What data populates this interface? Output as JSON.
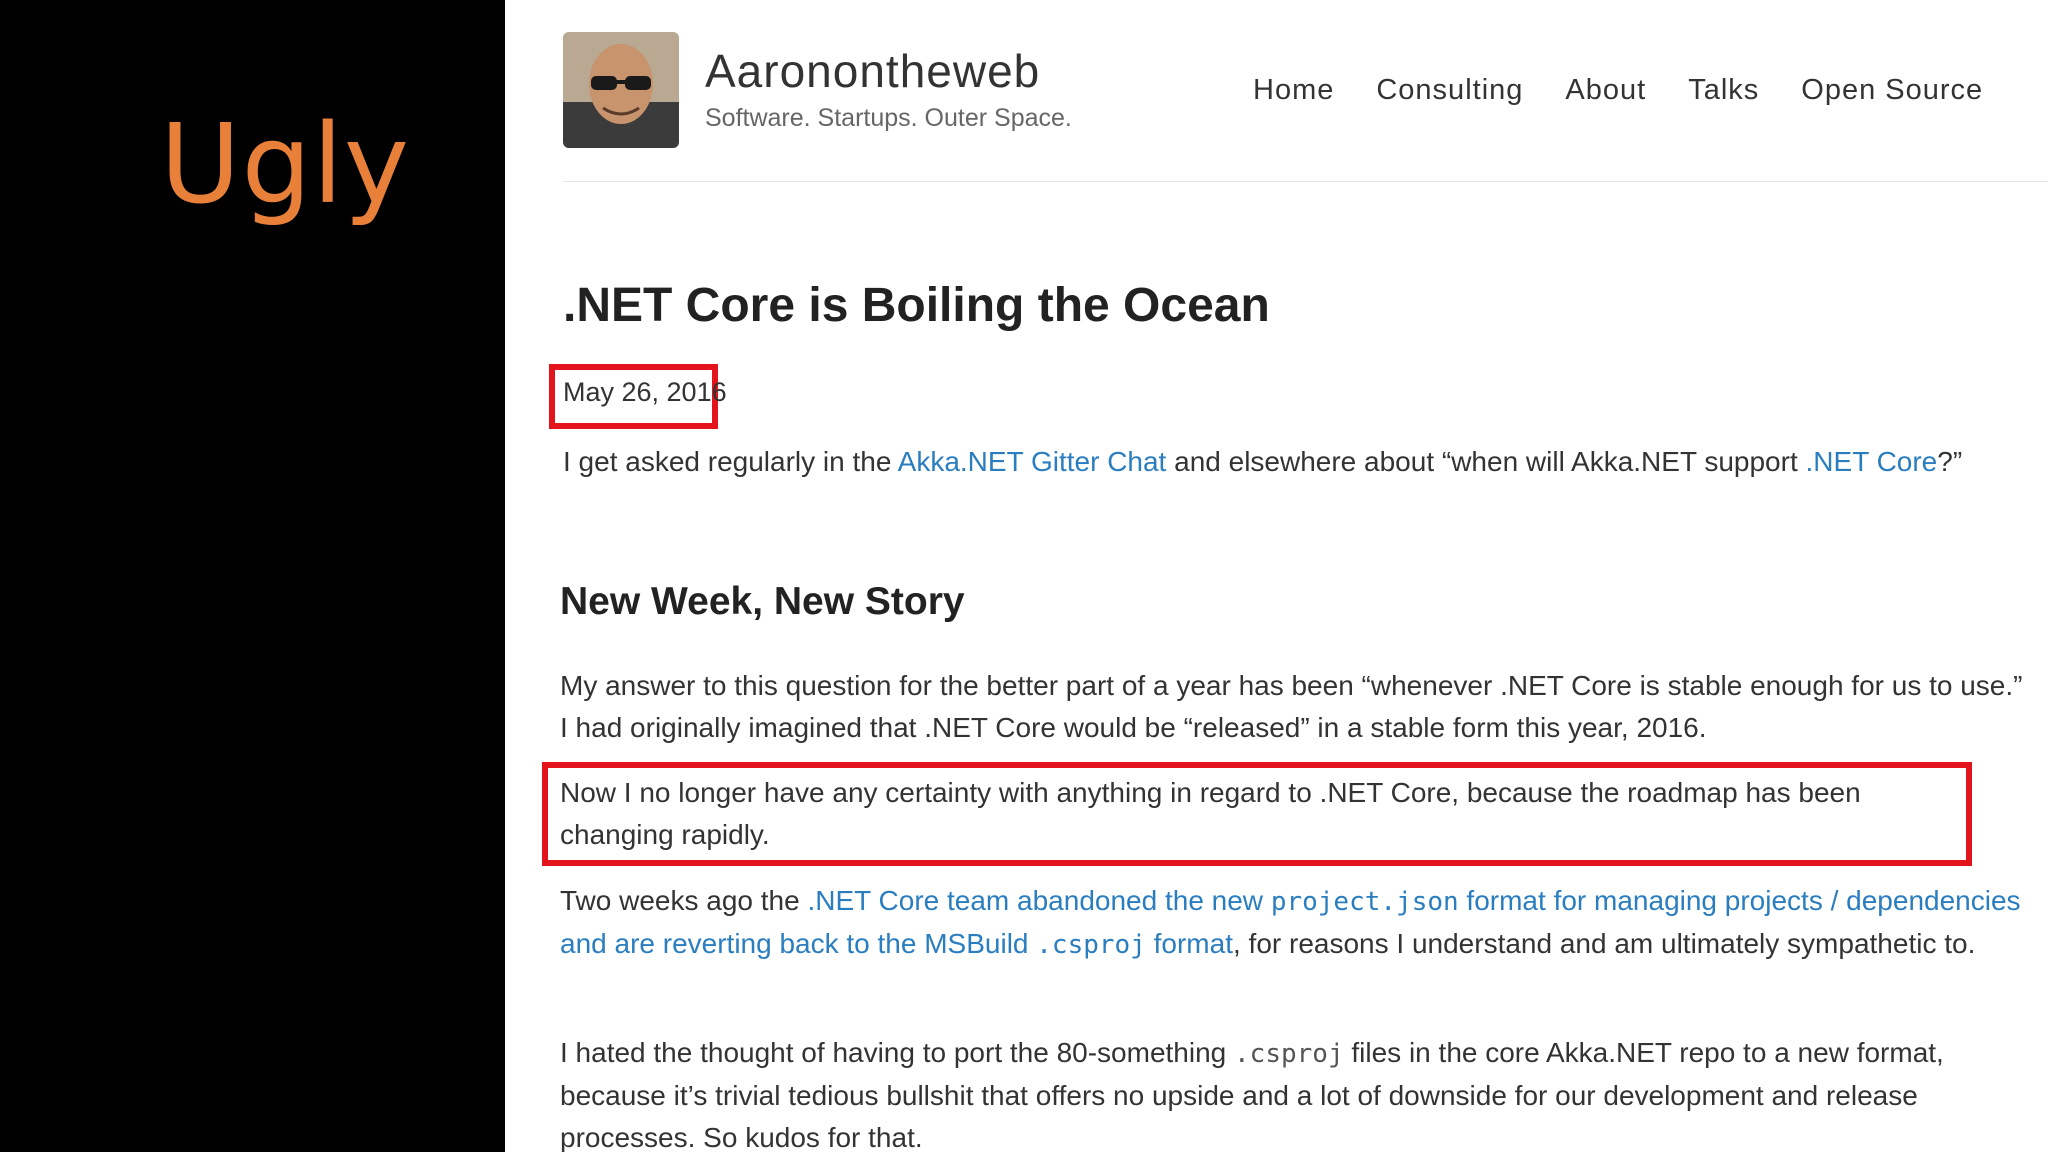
{
  "slide": {
    "title": "Ugly"
  },
  "site": {
    "title": "Aaronontheweb",
    "tagline": "Software. Startups. Outer Space.",
    "nav": [
      "Home",
      "Consulting",
      "About",
      "Talks",
      "Open Source"
    ]
  },
  "post": {
    "title": ".NET Core is Boiling the Ocean",
    "date": "May 26, 2016",
    "intro": {
      "t1": "I get asked regularly in the ",
      "link1": "Akka.NET Gitter Chat",
      "t2": " and elsewhere about “when will Akka.NET support ",
      "link2": ".NET Core",
      "t3": "?”"
    },
    "section_heading": "New Week, New Story",
    "p1": "My answer to this question for the better part of a year has been “whenever .NET Core is stable enough for us to use.” I had originally imagined that .NET Core would be “released” in a stable form this year, 2016.",
    "p2": "Now I no longer have any certainty with anything in regard to .NET Core, because the roadmap has been changing rapidly.",
    "p3": {
      "t1": "Two weeks ago the ",
      "link_a": ".NET Core team abandoned the new ",
      "code1": "project.json",
      "link_b": " format for managing projects / dependencies and are reverting back to the MSBuild ",
      "code2": ".csproj",
      "link_c": " format",
      "t2": ", for reasons I understand and am ultimately sympathetic to."
    },
    "p4": {
      "t1": "I hated the thought of having to port the 80-something ",
      "code": ".csproj",
      "t2": " files in the core Akka.NET repo to a new format, because it’s trivial tedious bullshit that offers no upside and a lot of downside for our development and release processes. So kudos for that."
    }
  },
  "colors": {
    "highlight_box": "#e3141c",
    "slide_title": "#e8803a",
    "link": "#2a7ec0"
  }
}
